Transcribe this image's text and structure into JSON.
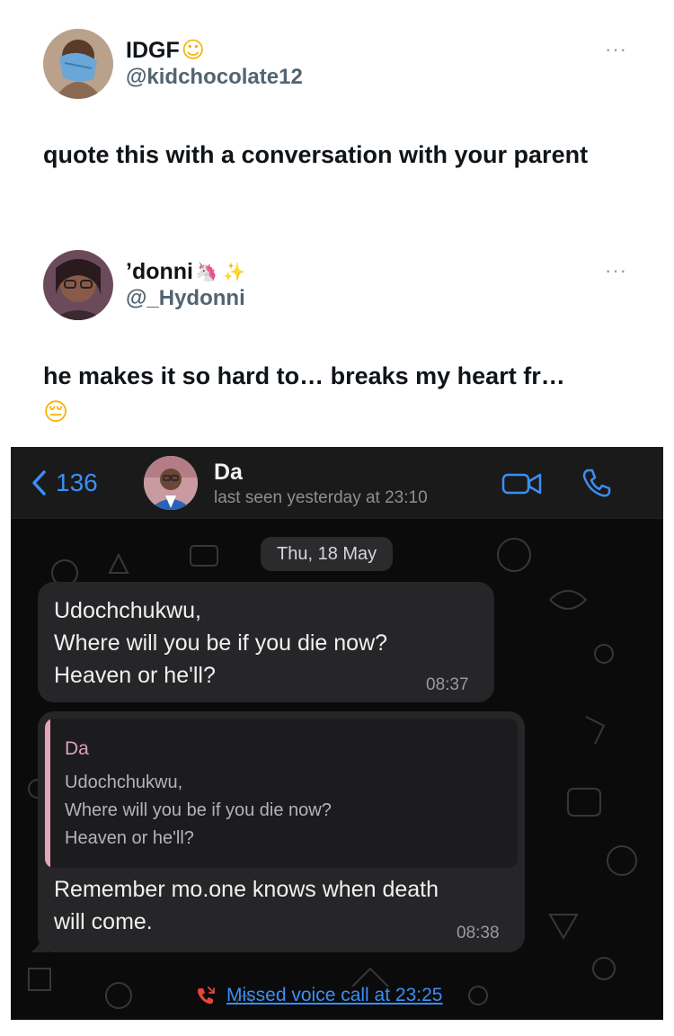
{
  "tweets": [
    {
      "display_name": "IDGF",
      "name_emoji": "☺",
      "handle": "@kidchocolate12",
      "more": "···",
      "text": "quote this with a conversation with your parent"
    },
    {
      "display_name": "’donni",
      "name_emoji": "🦄 ✨",
      "handle": "@_Hydonni",
      "more": "···",
      "text": "he makes it so hard to… breaks my heart fr…",
      "text_emoji": "😔"
    }
  ],
  "chat": {
    "back_count": "136",
    "contact_name": "Da",
    "last_seen": "last seen yesterday at 23:10",
    "date_separator": "Thu, 18 May",
    "messages": [
      {
        "lines": [
          "Udochchukwu,",
          "Where will you be if you die now?",
          "Heaven or he'll?"
        ],
        "time": "08:37"
      },
      {
        "quote": {
          "author": "Da",
          "lines": [
            "Udochchukwu,",
            "Where will you be if you die now?",
            "Heaven or he'll?"
          ]
        },
        "lines": [
          "Remember mo.one knows when death",
          "will come."
        ],
        "time": "08:38"
      }
    ],
    "missed_call": "Missed voice call at 23:25",
    "colors": {
      "accent": "#3a8ff6",
      "missed_call_icon": "#e8453c",
      "quote_bar": "#e7a3b9"
    }
  },
  "icons": [
    "back-chevron-icon",
    "video-call-icon",
    "voice-call-icon",
    "missed-call-icon",
    "more-icon"
  ]
}
